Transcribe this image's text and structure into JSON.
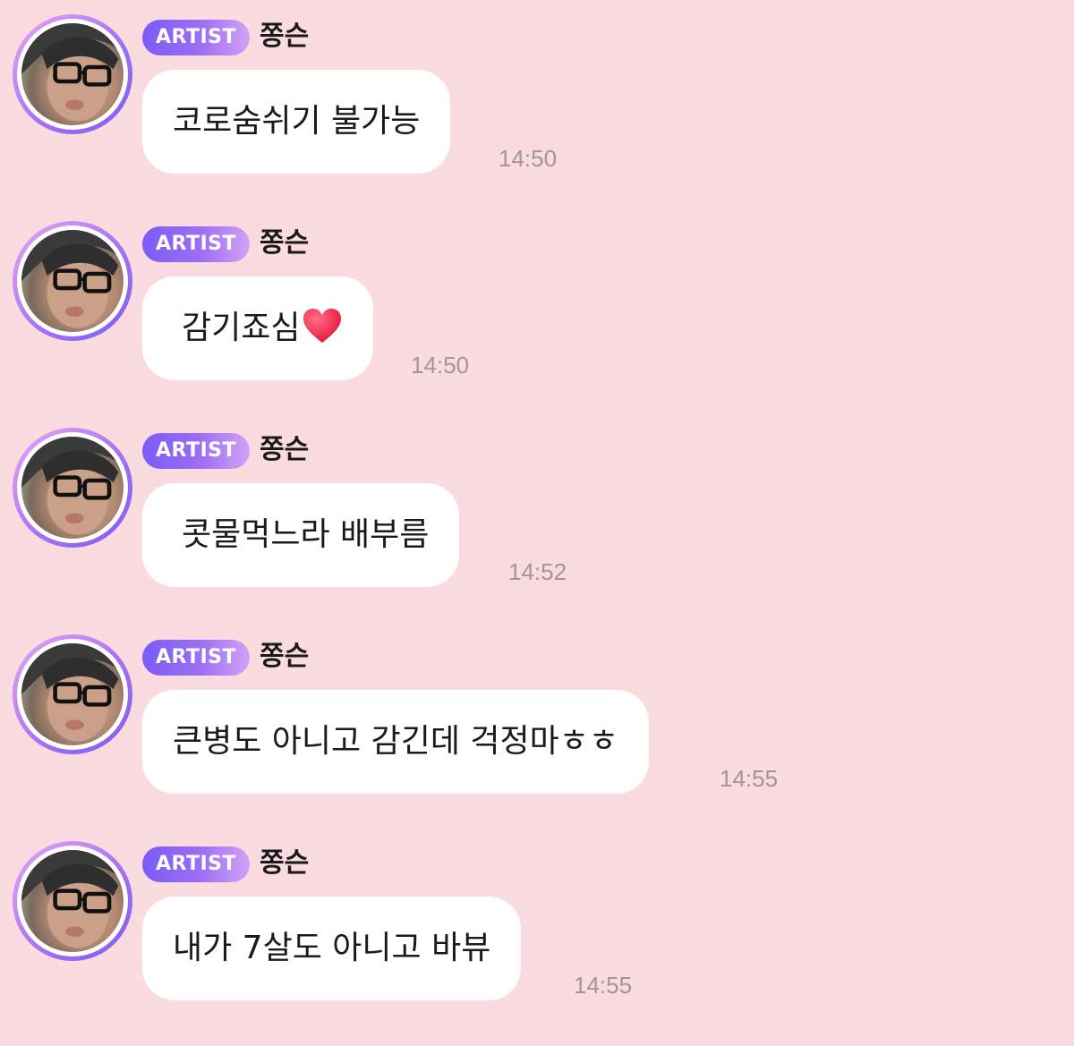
{
  "colors": {
    "background": "#f9dbe0",
    "bubble": "#ffffff",
    "badge_start": "#7a5cf6",
    "badge_end": "#d3a2f5",
    "timestamp": "#a2959a"
  },
  "messages": [
    {
      "badge": "ARTIST",
      "sender": "쫑슨",
      "text": "코로숨쉬기 불가능",
      "time": "14:50"
    },
    {
      "badge": "ARTIST",
      "sender": "쫑슨",
      "text": "감기죠심",
      "emoji": "red-heart-icon",
      "time": "14:50"
    },
    {
      "badge": "ARTIST",
      "sender": "쫑슨",
      "text": "콧물먹느라 배부름",
      "time": "14:52"
    },
    {
      "badge": "ARTIST",
      "sender": "쫑슨",
      "text": "큰병도 아니고 감긴데 걱정마ㅎㅎ",
      "time": "14:55"
    },
    {
      "badge": "ARTIST",
      "sender": "쫑슨",
      "text": "내가 7살도 아니고 바뷰",
      "time": "14:55"
    }
  ]
}
